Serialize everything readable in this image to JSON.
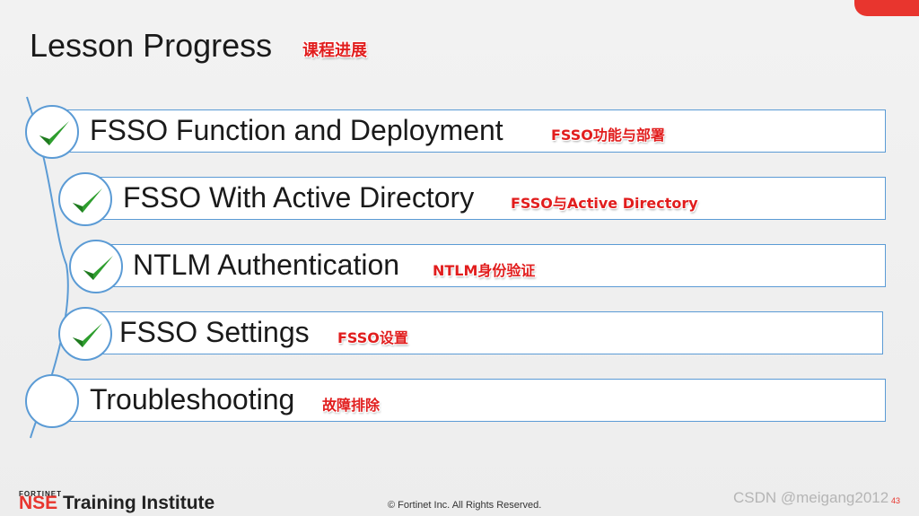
{
  "slide": {
    "title": "Lesson Progress",
    "title_cn": "课程进展"
  },
  "lessons": [
    {
      "label": "FSSO Function and Deployment",
      "cn": "FSSO功能与部署",
      "completed": true
    },
    {
      "label": "FSSO With Active Directory",
      "cn": "FSSO与Active Directory",
      "completed": true
    },
    {
      "label": "NTLM Authentication",
      "cn": "NTLM身份验证",
      "completed": true
    },
    {
      "label": "FSSO Settings",
      "cn": "FSSO设置",
      "completed": true
    },
    {
      "label": "Troubleshooting",
      "cn": "故障排除",
      "completed": false
    }
  ],
  "footer": {
    "logo_top": "FORTINET",
    "logo_nse": "NSE",
    "logo_rest": " Training Institute",
    "copyright": "© Fortinet Inc. All Rights Reserved.",
    "page_number": "43"
  },
  "watermark": "CSDN @meigang2012",
  "colors": {
    "accent_red": "#e8352e",
    "row_border": "#5b9bd5",
    "check_green": "#2e9e2e",
    "cn_label": "#e11d1d"
  }
}
